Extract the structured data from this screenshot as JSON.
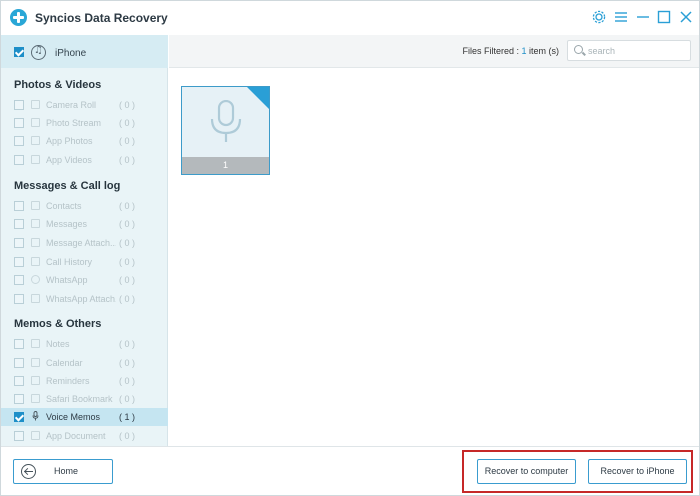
{
  "app": {
    "title": "Syncios Data Recovery",
    "accent": "#1e8fc8",
    "highlight_color": "#c62828"
  },
  "window_controls": [
    "gear-icon",
    "menu-icon",
    "minimize-icon",
    "maximize-icon",
    "close-icon"
  ],
  "device": {
    "label": "iPhone",
    "checked": true,
    "icon": "music-note-icon"
  },
  "sidebar": {
    "sections": [
      {
        "title": "Photos & Videos",
        "items": [
          {
            "label": "Camera Roll",
            "count": "( 0 )"
          },
          {
            "label": "Photo Stream",
            "count": "( 0 )"
          },
          {
            "label": "App Photos",
            "count": "( 0 )"
          },
          {
            "label": "App Videos",
            "count": "( 0 )"
          }
        ]
      },
      {
        "title": "Messages & Call log",
        "items": [
          {
            "label": "Contacts",
            "count": "( 0 )"
          },
          {
            "label": "Messages",
            "count": "( 0 )"
          },
          {
            "label": "Message Attach...",
            "count": "( 0 )"
          },
          {
            "label": "Call History",
            "count": "( 0 )"
          },
          {
            "label": "WhatsApp",
            "count": "( 0 )"
          },
          {
            "label": "WhatsApp Attach...",
            "count": "( 0 )"
          }
        ]
      },
      {
        "title": "Memos & Others",
        "items": [
          {
            "label": "Notes",
            "count": "( 0 )"
          },
          {
            "label": "Calendar",
            "count": "( 0 )"
          },
          {
            "label": "Reminders",
            "count": "( 0 )"
          },
          {
            "label": "Safari Bookmark",
            "count": "( 0 )"
          },
          {
            "label": "Voice Memos",
            "count": "( 1 )",
            "checked": true,
            "selected": true
          },
          {
            "label": "App Document",
            "count": "( 0 )"
          }
        ]
      }
    ]
  },
  "toolbar": {
    "filtered_prefix": "Files Filtered : ",
    "filtered_count": "1",
    "filtered_suffix": " item (s)",
    "search_placeholder": "search"
  },
  "content": {
    "tiles": [
      {
        "caption": "1",
        "icon": "microphone-icon"
      }
    ]
  },
  "footer": {
    "home_label": "Home",
    "recover_computer_label": "Recover to computer",
    "recover_iphone_label": "Recover to iPhone"
  }
}
